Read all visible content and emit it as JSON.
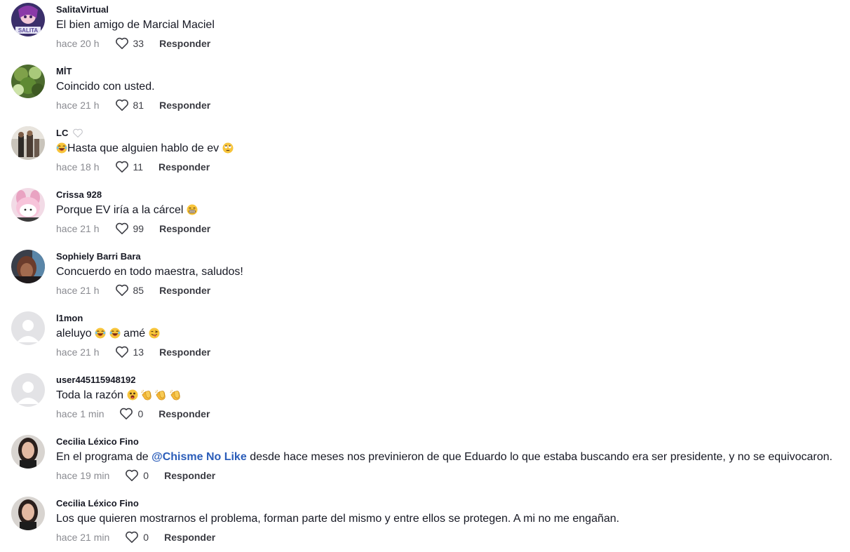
{
  "comments": [
    {
      "username": "SalitaVirtual",
      "text": "El bien amigo de Marcial Maciel",
      "time": "hace 20 h",
      "likes": "33",
      "reply": "Responder",
      "avatar": "avatar-photo-anime"
    },
    {
      "username": "MİT",
      "text": "Coincido con usted.",
      "time": "hace 21 h",
      "likes": "81",
      "reply": "Responder",
      "avatar": "avatar-photo-plant"
    },
    {
      "username": "LC",
      "text_parts": [
        "Hasta que alguien hablo de ev"
      ],
      "time": "hace 18 h",
      "likes": "11",
      "reply": "Responder",
      "avatar": "avatar-photo-people"
    },
    {
      "username": "Crissa 928",
      "text": "Porque EV iría a la cárcel",
      "time": "hace 21 h",
      "likes": "99",
      "reply": "Responder",
      "avatar": "avatar-photo-melody"
    },
    {
      "username": "Sophiely Barri Bara",
      "text": "Concuerdo en todo maestra, saludos!",
      "time": "hace 21 h",
      "likes": "85",
      "reply": "Responder",
      "avatar": "avatar-photo-dark"
    },
    {
      "username": "l1mon",
      "text_parts": [
        "aleluyo",
        "amé"
      ],
      "time": "hace 21 h",
      "likes": "13",
      "reply": "Responder",
      "avatar": "avatar-default"
    },
    {
      "username": "user445115948192",
      "text": "Toda la razón",
      "time": "hace 1 min",
      "likes": "0",
      "reply": "Responder",
      "avatar": "avatar-default"
    },
    {
      "username": "Cecilia Léxico Fino",
      "text_before": "En el programa de",
      "mention": "@Chisme No Like",
      "text_after": "desde hace meses nos previnieron de que Eduardo lo que estaba buscando era ser presidente, y no se equivocaron.",
      "time": "hace 19 min",
      "likes": "0",
      "reply": "Responder",
      "avatar": "avatar-photo-woman"
    },
    {
      "username": "Cecilia Léxico Fino",
      "text": "Los que quieren mostrarnos el problema, forman parte del mismo y entre ellos se protegen. A mi no me engañan.",
      "time": "hace 21 min",
      "likes": "0",
      "reply": "Responder",
      "avatar": "avatar-photo-woman"
    }
  ],
  "colors": {
    "text": "#161823",
    "meta": "#8a8b91",
    "mention": "#2b5db9",
    "reply": "#3a3b42"
  },
  "icons": [
    "heart-outline-icon",
    "laughing-emoji-icon",
    "eye-roll-emoji-icon",
    "grin-emoji-icon",
    "tongue-emoji-icon",
    "surprised-emoji-icon",
    "clapping-hands-emoji-icon",
    "white-heart-icon"
  ]
}
